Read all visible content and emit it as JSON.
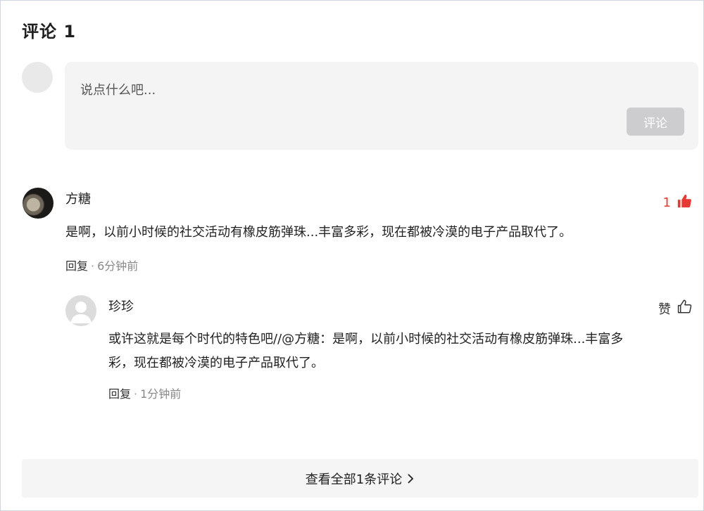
{
  "header": {
    "title": "评论 1"
  },
  "composer": {
    "placeholder": "说点什么吧...",
    "submit_label": "评论"
  },
  "comments": [
    {
      "username": "方糖",
      "text": "是啊，以前小时候的社交活动有橡皮筋弹珠...丰富多彩，现在都被冷漠的电子产品取代了。",
      "reply_label": "回复",
      "time": "6分钟前",
      "like_count": "1",
      "liked": true,
      "avatar_icon": "user-photo",
      "replies": [
        {
          "username": "珍珍",
          "text_line1": "或许这就是每个时代的特色吧//@方糖：是啊，以前小时候的社交活动有橡皮筋弹珠...丰富多",
          "text_line2": "彩，现在都被冷漠的电子产品取代了。",
          "reply_label": "回复",
          "time": "1分钟前",
          "like_label": "赞",
          "liked": false,
          "avatar_icon": "default-avatar-icon"
        }
      ]
    }
  ],
  "footer": {
    "view_all_label": "查看全部1条评论"
  },
  "colors": {
    "liked": "#e53935",
    "button_disabled": "#cdcdcf",
    "input_bg": "#f4f4f5"
  },
  "icons": {
    "like_filled": "thumbs-up-filled-icon",
    "like_outline": "thumbs-up-outline-icon",
    "chevron": "chevron-right-icon"
  }
}
